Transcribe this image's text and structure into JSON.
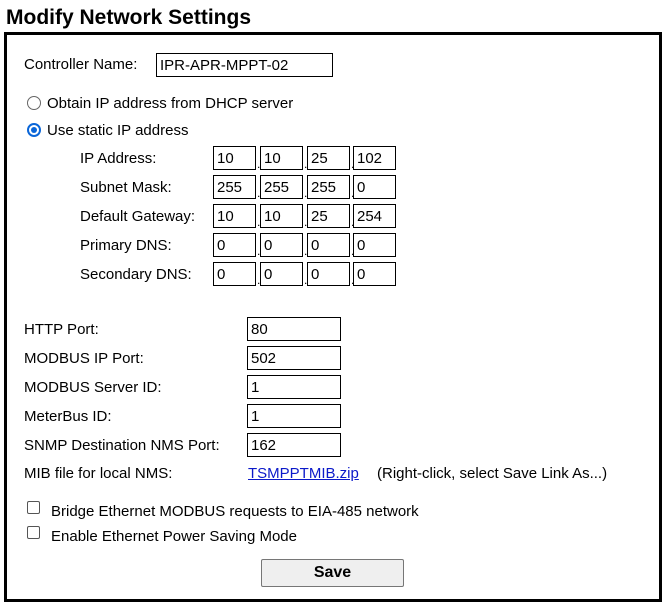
{
  "page": {
    "title": "Modify Network Settings"
  },
  "controller": {
    "label": "Controller Name:",
    "value": "IPR-APR-MPPT-02"
  },
  "ip_mode": {
    "dhcp_label": "Obtain IP address from DHCP server",
    "static_label": "Use static IP address",
    "selected": "static"
  },
  "ip_rows": [
    {
      "label": "IP Address:",
      "octets": [
        "10",
        "10",
        "25",
        "102"
      ]
    },
    {
      "label": "Subnet Mask:",
      "octets": [
        "255",
        "255",
        "255",
        "0"
      ]
    },
    {
      "label": "Default Gateway:",
      "octets": [
        "10",
        "10",
        "25",
        "254"
      ]
    },
    {
      "label": "Primary DNS:",
      "octets": [
        "0",
        "0",
        "0",
        "0"
      ]
    },
    {
      "label": "Secondary DNS:",
      "octets": [
        "0",
        "0",
        "0",
        "0"
      ]
    }
  ],
  "ports": [
    {
      "label": "HTTP Port:",
      "value": "80"
    },
    {
      "label": "MODBUS IP Port:",
      "value": "502"
    },
    {
      "label": "MODBUS Server ID:",
      "value": "1"
    },
    {
      "label": "MeterBus ID:",
      "value": "1"
    },
    {
      "label": "SNMP Destination NMS Port:",
      "value": "162"
    }
  ],
  "mib": {
    "label": "MIB file for local NMS:",
    "link_text": "TSMPPTMIB.zip",
    "note": "(Right-click, select Save Link As...)"
  },
  "options": [
    {
      "label": "Bridge Ethernet MODBUS requests to EIA-485 network",
      "checked": false
    },
    {
      "label": "Enable Ethernet Power Saving Mode",
      "checked": false
    }
  ],
  "save_label": "Save",
  "colors": {
    "radio_selected": "#0a66d8",
    "link": "#0b19c9"
  }
}
